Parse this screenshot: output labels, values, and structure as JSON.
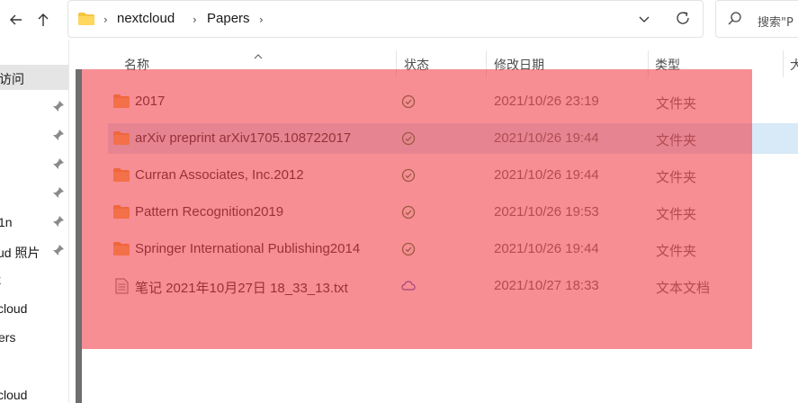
{
  "address": {
    "crumbs": [
      "nextcloud",
      "Papers"
    ]
  },
  "search": {
    "placeholder": "搜索\"P"
  },
  "sidebar": {
    "items": [
      {
        "label": "访问"
      },
      {
        "label": ""
      },
      {
        "label": ""
      },
      {
        "label": ""
      },
      {
        "label": ""
      },
      {
        "label": "1n"
      },
      {
        "label": "ud 照片"
      },
      {
        "label": "k"
      },
      {
        "label": "cloud"
      },
      {
        "label": "ers"
      },
      {
        "label": ""
      },
      {
        "label": "cloud"
      }
    ]
  },
  "columns": {
    "name": "名称",
    "status": "状态",
    "modified": "修改日期",
    "type": "类型",
    "size": "大"
  },
  "files": [
    {
      "name": "2017",
      "modified": "2021/10/26 23:19",
      "type": "文件夹",
      "kind": "folder",
      "status": "synced"
    },
    {
      "name": "arXiv preprint arXiv1705.108722017",
      "modified": "2021/10/26 19:44",
      "type": "文件夹",
      "kind": "folder",
      "status": "synced"
    },
    {
      "name": "Curran Associates, Inc.2012",
      "modified": "2021/10/26 19:44",
      "type": "文件夹",
      "kind": "folder",
      "status": "synced"
    },
    {
      "name": "Pattern Recognition2019",
      "modified": "2021/10/26 19:53",
      "type": "文件夹",
      "kind": "folder",
      "status": "synced"
    },
    {
      "name": "Springer International Publishing2014",
      "modified": "2021/10/26 19:44",
      "type": "文件夹",
      "kind": "folder",
      "status": "synced"
    },
    {
      "name": "笔记 2021年10月27日 18_33_13.txt",
      "modified": "2021/10/27 18:33",
      "type": "文本文档",
      "kind": "text",
      "status": "cloud"
    }
  ],
  "colors": {
    "folder": "#f0a030",
    "synced": "#2e7d32",
    "cloud": "#3f51b5",
    "overlay": "#f03c46",
    "hover": "#d8e9f7"
  }
}
